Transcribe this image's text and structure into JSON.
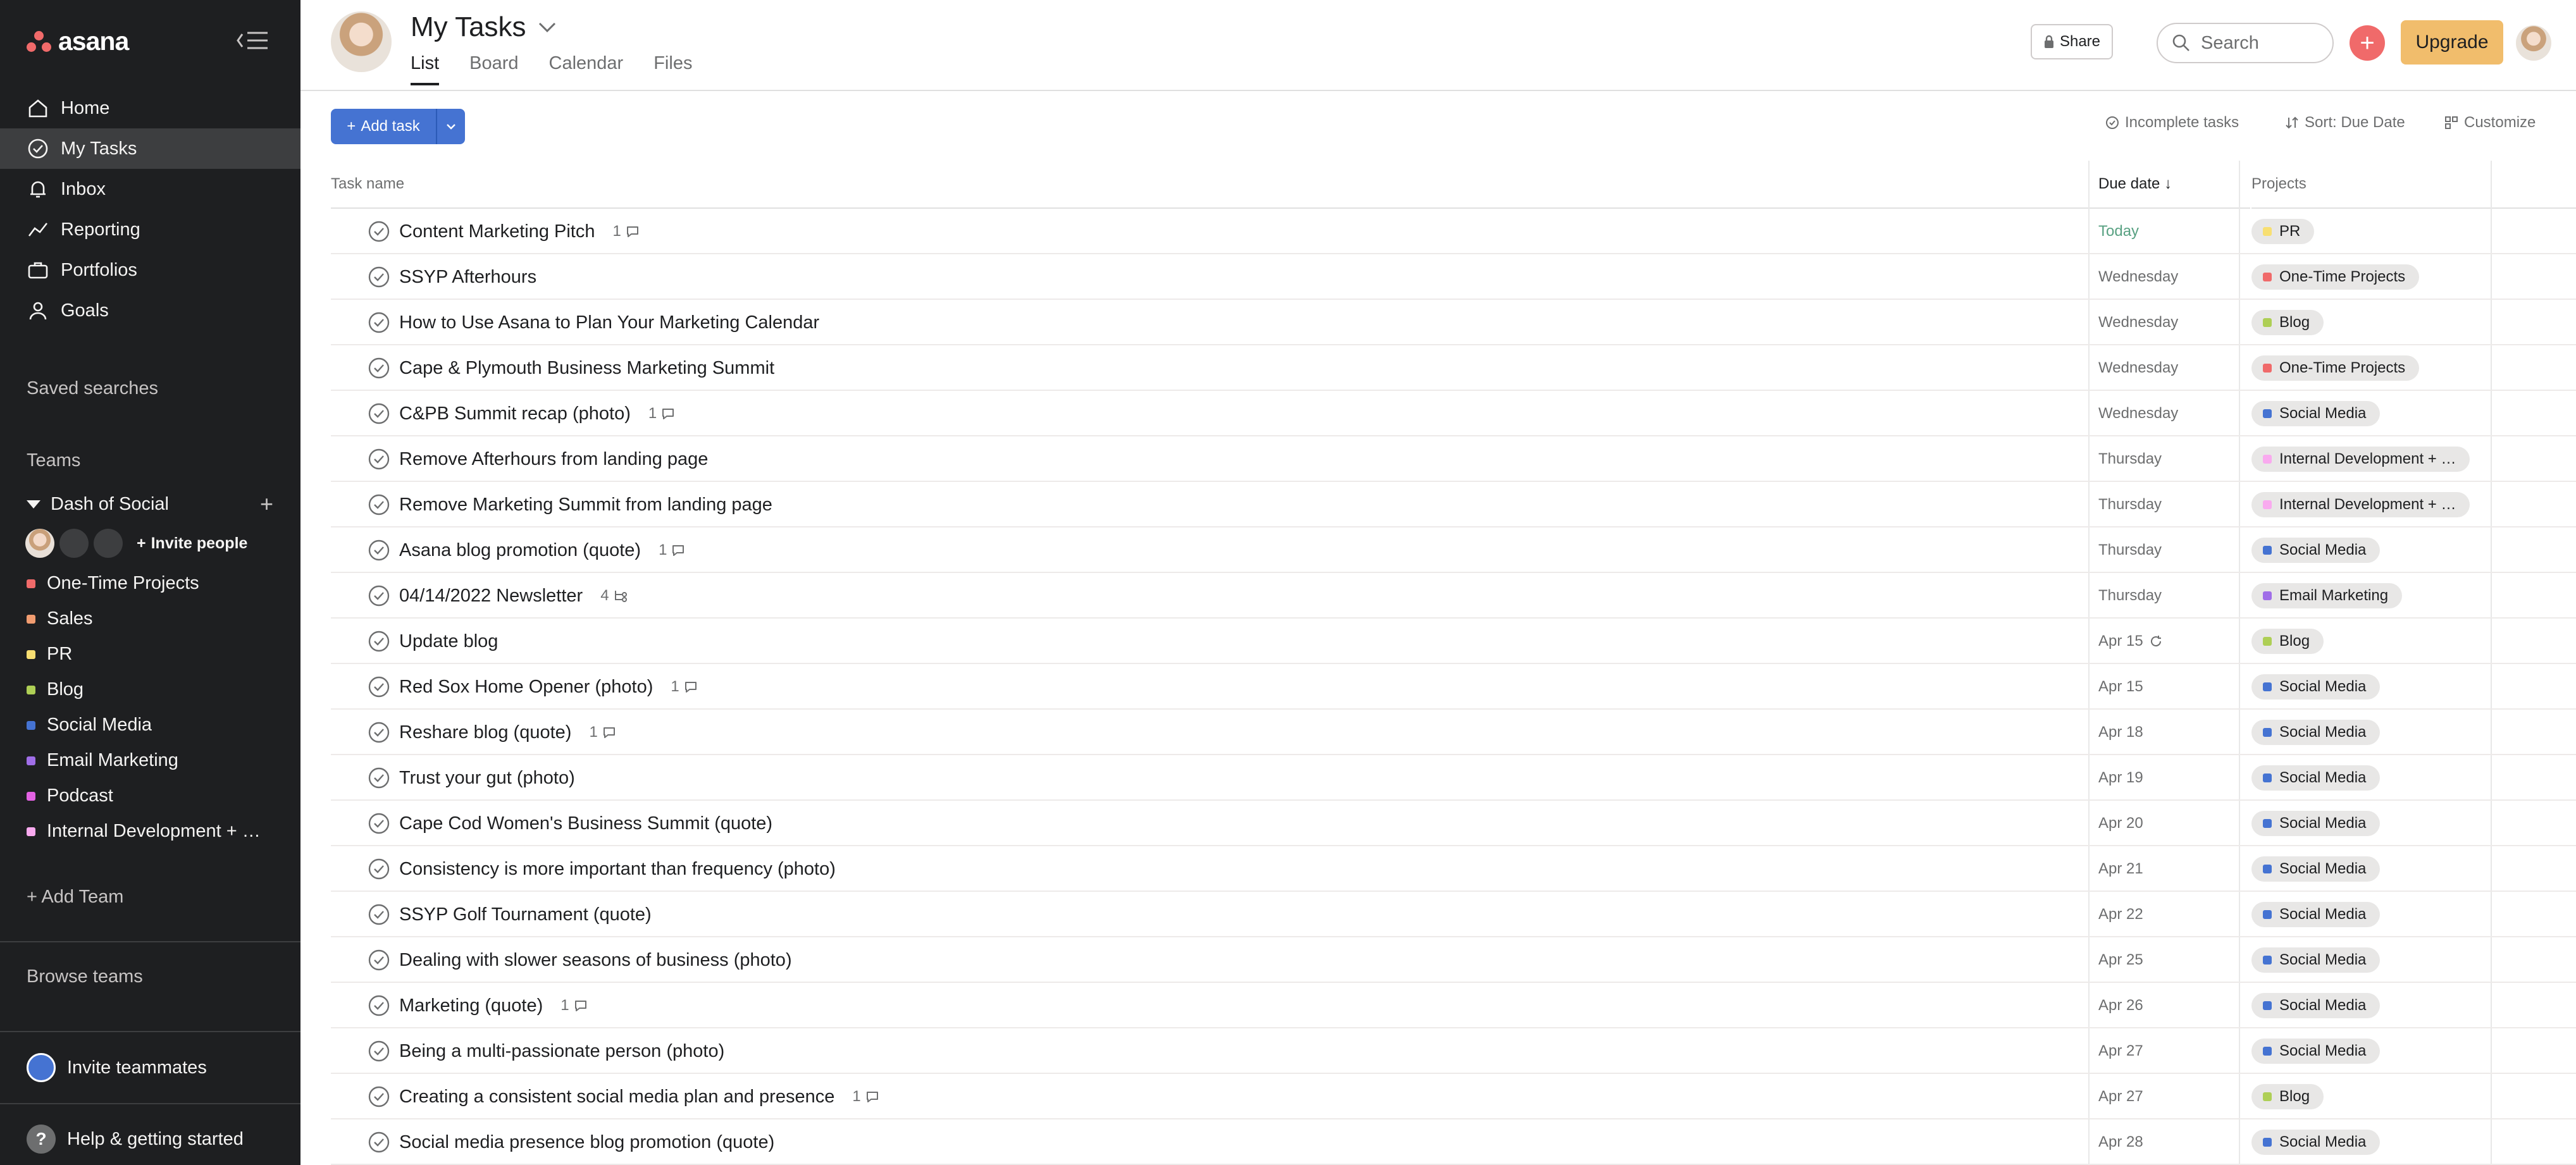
{
  "sidebar": {
    "brand": "asana",
    "nav": [
      {
        "label": "Home",
        "icon": "home-icon"
      },
      {
        "label": "My Tasks",
        "icon": "check-circle-icon"
      },
      {
        "label": "Inbox",
        "icon": "bell-icon"
      },
      {
        "label": "Reporting",
        "icon": "chart-line-icon"
      },
      {
        "label": "Portfolios",
        "icon": "portfolio-icon"
      },
      {
        "label": "Goals",
        "icon": "person-icon"
      }
    ],
    "saved_searches": "Saved searches",
    "teams_label": "Teams",
    "team_name": "Dash of Social",
    "invite_people": "Invite people",
    "projects": [
      {
        "label": "One-Time Projects",
        "color": "#f06a6a"
      },
      {
        "label": "Sales",
        "color": "#f19c70"
      },
      {
        "label": "PR",
        "color": "#f8df72"
      },
      {
        "label": "Blog",
        "color": "#aecf55"
      },
      {
        "label": "Social Media",
        "color": "#4573d2"
      },
      {
        "label": "Email Marketing",
        "color": "#a06ee8"
      },
      {
        "label": "Podcast",
        "color": "#e362e3"
      },
      {
        "label": "Internal Development + …",
        "color": "#f9aaef"
      }
    ],
    "add_team": "Add Team",
    "browse_teams": "Browse teams",
    "invite_teammates": "Invite teammates",
    "help": "Help & getting started"
  },
  "header": {
    "title": "My Tasks",
    "tabs": [
      "List",
      "Board",
      "Calendar",
      "Files"
    ],
    "share": "Share",
    "search_placeholder": "Search",
    "upgrade": "Upgrade"
  },
  "toolbar": {
    "add_task": "Add task",
    "incomplete": "Incomplete tasks",
    "sort": "Sort: Due Date",
    "customize": "Customize"
  },
  "columns": {
    "task": "Task name",
    "due": "Due date",
    "projects": "Projects"
  },
  "colors": {
    "accent": "#4573d2",
    "today": "#58a182",
    "sidebar_bg": "#1e1f21"
  },
  "tasks": [
    {
      "name": "Content Marketing Pitch",
      "meta": "1",
      "meta_type": "comment",
      "due": "Today",
      "project": "PR",
      "pcolor": "#f8df72"
    },
    {
      "name": "SSYP Afterhours",
      "meta": "",
      "meta_type": "",
      "due": "Wednesday",
      "project": "One-Time Projects",
      "pcolor": "#f06a6a"
    },
    {
      "name": "How to Use Asana to Plan Your Marketing Calendar",
      "meta": "",
      "meta_type": "",
      "due": "Wednesday",
      "project": "Blog",
      "pcolor": "#aecf55"
    },
    {
      "name": "Cape & Plymouth Business Marketing Summit",
      "meta": "",
      "meta_type": "",
      "due": "Wednesday",
      "project": "One-Time Projects",
      "pcolor": "#f06a6a"
    },
    {
      "name": "C&PB Summit recap (photo)",
      "meta": "1",
      "meta_type": "comment",
      "due": "Wednesday",
      "project": "Social Media",
      "pcolor": "#4573d2"
    },
    {
      "name": "Remove Afterhours from landing page",
      "meta": "",
      "meta_type": "",
      "due": "Thursday",
      "project": "Internal Development + …",
      "pcolor": "#f9aaef"
    },
    {
      "name": "Remove Marketing Summit from landing page",
      "meta": "",
      "meta_type": "",
      "due": "Thursday",
      "project": "Internal Development + …",
      "pcolor": "#f9aaef"
    },
    {
      "name": "Asana blog promotion (quote)",
      "meta": "1",
      "meta_type": "comment",
      "due": "Thursday",
      "project": "Social Media",
      "pcolor": "#4573d2"
    },
    {
      "name": "04/14/2022 Newsletter",
      "meta": "4",
      "meta_type": "subtask",
      "due": "Thursday",
      "project": "Email Marketing",
      "pcolor": "#a06ee8"
    },
    {
      "name": "Update blog",
      "meta": "",
      "meta_type": "",
      "due": "Apr 15",
      "due_icon": "repeat",
      "project": "Blog",
      "pcolor": "#aecf55"
    },
    {
      "name": "Red Sox Home Opener (photo)",
      "meta": "1",
      "meta_type": "comment",
      "due": "Apr 15",
      "project": "Social Media",
      "pcolor": "#4573d2"
    },
    {
      "name": "Reshare blog (quote)",
      "meta": "1",
      "meta_type": "comment",
      "due": "Apr 18",
      "project": "Social Media",
      "pcolor": "#4573d2"
    },
    {
      "name": "Trust your gut (photo)",
      "meta": "",
      "meta_type": "",
      "due": "Apr 19",
      "project": "Social Media",
      "pcolor": "#4573d2"
    },
    {
      "name": "Cape Cod Women's Business Summit (quote)",
      "meta": "",
      "meta_type": "",
      "due": "Apr 20",
      "project": "Social Media",
      "pcolor": "#4573d2"
    },
    {
      "name": "Consistency is more important than frequency (photo)",
      "meta": "",
      "meta_type": "",
      "due": "Apr 21",
      "project": "Social Media",
      "pcolor": "#4573d2"
    },
    {
      "name": "SSYP Golf Tournament (quote)",
      "meta": "",
      "meta_type": "",
      "due": "Apr 22",
      "project": "Social Media",
      "pcolor": "#4573d2"
    },
    {
      "name": "Dealing with slower seasons of business (photo)",
      "meta": "",
      "meta_type": "",
      "due": "Apr 25",
      "project": "Social Media",
      "pcolor": "#4573d2"
    },
    {
      "name": "Marketing (quote)",
      "meta": "1",
      "meta_type": "comment",
      "due": "Apr 26",
      "project": "Social Media",
      "pcolor": "#4573d2"
    },
    {
      "name": "Being a multi-passionate person (photo)",
      "meta": "",
      "meta_type": "",
      "due": "Apr 27",
      "project": "Social Media",
      "pcolor": "#4573d2"
    },
    {
      "name": "Creating a consistent social media plan and presence",
      "meta": "1",
      "meta_type": "comment",
      "due": "Apr 27",
      "project": "Blog",
      "pcolor": "#aecf55"
    },
    {
      "name": "Social media presence blog promotion (quote)",
      "meta": "",
      "meta_type": "",
      "due": "Apr 28",
      "project": "Social Media",
      "pcolor": "#4573d2"
    }
  ]
}
